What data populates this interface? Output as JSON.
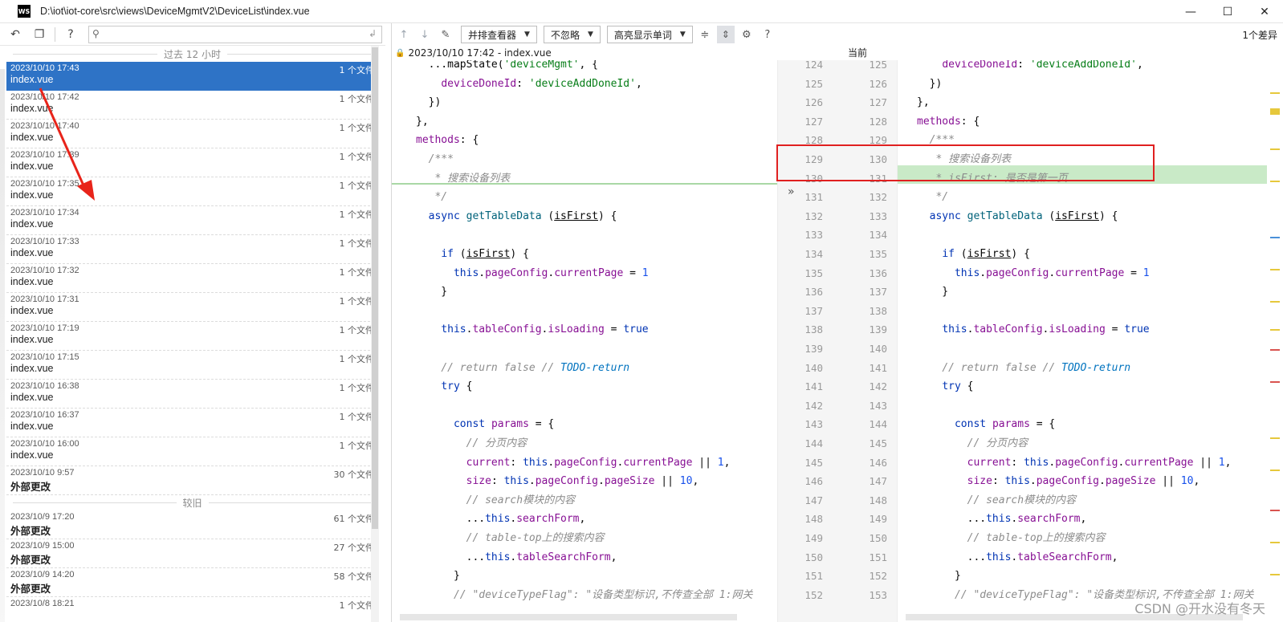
{
  "window": {
    "app_logo": "WS",
    "title": "D:\\iot\\iot-core\\src\\views\\DeviceMgmtV2\\DeviceList\\index.vue",
    "minimize": "—",
    "maximize": "☐",
    "close": "✕"
  },
  "left_toolbar": {
    "revert_icon": "↶",
    "copy_icon": "❐",
    "help_icon": "?",
    "search_icon": "⚲",
    "search_value": "",
    "clear_icon": "↲"
  },
  "history": {
    "group_recent": "过去 12 小时",
    "group_older": "较旧",
    "recent_items": [
      {
        "date": "2023/10/10 17:43",
        "count": "1 个文件",
        "name": "index.vue"
      },
      {
        "date": "2023/10/10 17:42",
        "count": "1 个文件",
        "name": "index.vue"
      },
      {
        "date": "2023/10/10 17:40",
        "count": "1 个文件",
        "name": "index.vue"
      },
      {
        "date": "2023/10/10 17:39",
        "count": "1 个文件",
        "name": "index.vue"
      },
      {
        "date": "2023/10/10 17:35",
        "count": "1 个文件",
        "name": "index.vue"
      },
      {
        "date": "2023/10/10 17:34",
        "count": "1 个文件",
        "name": "index.vue"
      },
      {
        "date": "2023/10/10 17:33",
        "count": "1 个文件",
        "name": "index.vue"
      },
      {
        "date": "2023/10/10 17:32",
        "count": "1 个文件",
        "name": "index.vue"
      },
      {
        "date": "2023/10/10 17:31",
        "count": "1 个文件",
        "name": "index.vue"
      },
      {
        "date": "2023/10/10 17:19",
        "count": "1 个文件",
        "name": "index.vue"
      },
      {
        "date": "2023/10/10 17:15",
        "count": "1 个文件",
        "name": "index.vue"
      },
      {
        "date": "2023/10/10 16:38",
        "count": "1 个文件",
        "name": "index.vue"
      },
      {
        "date": "2023/10/10 16:37",
        "count": "1 个文件",
        "name": "index.vue"
      },
      {
        "date": "2023/10/10 16:00",
        "count": "1 个文件",
        "name": "index.vue"
      },
      {
        "date": "2023/10/10 9:57",
        "count": "30 个文件",
        "name": "外部更改"
      }
    ],
    "older_items": [
      {
        "date": "2023/10/9 17:20",
        "count": "61 个文件",
        "name": "外部更改"
      },
      {
        "date": "2023/10/9 15:00",
        "count": "27 个文件",
        "name": "外部更改"
      },
      {
        "date": "2023/10/9 14:20",
        "count": "58 个文件",
        "name": "外部更改"
      },
      {
        "date": "2023/10/8 18:21",
        "count": "1 个文件",
        "name": ""
      }
    ]
  },
  "diff_toolbar": {
    "prev_icon": "↑",
    "next_icon": "↓",
    "edit_icon": "✎",
    "viewer_mode": "并排查看器",
    "whitespace_mode": "不忽略",
    "highlight_mode": "高亮显示单词",
    "collapse_icon": "≑",
    "sync_icon": "⇕",
    "settings_icon": "⚙",
    "help_icon": "?",
    "diff_count": "1个差异"
  },
  "file_headers": {
    "left": "2023/10/10 17:42 - index.vue",
    "right": "当前"
  },
  "gutter_lines": [
    {
      "left": "124",
      "right": "125"
    },
    {
      "left": "125",
      "right": "126"
    },
    {
      "left": "126",
      "right": "127"
    },
    {
      "left": "127",
      "right": "128"
    },
    {
      "left": "128",
      "right": "129"
    },
    {
      "left": "129",
      "right": "130"
    },
    {
      "left": "130",
      "right": "131"
    },
    {
      "left": "131",
      "right": "132"
    },
    {
      "left": "132",
      "right": "133"
    },
    {
      "left": "133",
      "right": "134"
    },
    {
      "left": "134",
      "right": "135"
    },
    {
      "left": "135",
      "right": "136"
    },
    {
      "left": "136",
      "right": "137"
    },
    {
      "left": "137",
      "right": "138"
    },
    {
      "left": "138",
      "right": "139"
    },
    {
      "left": "139",
      "right": "140"
    },
    {
      "left": "140",
      "right": "141"
    },
    {
      "left": "141",
      "right": "142"
    },
    {
      "left": "142",
      "right": "143"
    },
    {
      "left": "143",
      "right": "144"
    },
    {
      "left": "144",
      "right": "145"
    },
    {
      "left": "145",
      "right": "146"
    },
    {
      "left": "146",
      "right": "147"
    },
    {
      "left": "147",
      "right": "148"
    },
    {
      "left": "148",
      "right": "149"
    },
    {
      "left": "149",
      "right": "150"
    },
    {
      "left": "150",
      "right": "151"
    },
    {
      "left": "151",
      "right": "152"
    },
    {
      "left": "152",
      "right": "153"
    }
  ],
  "gutter_apply_icon": "»",
  "watermark": "CSDN @开水没有冬天"
}
